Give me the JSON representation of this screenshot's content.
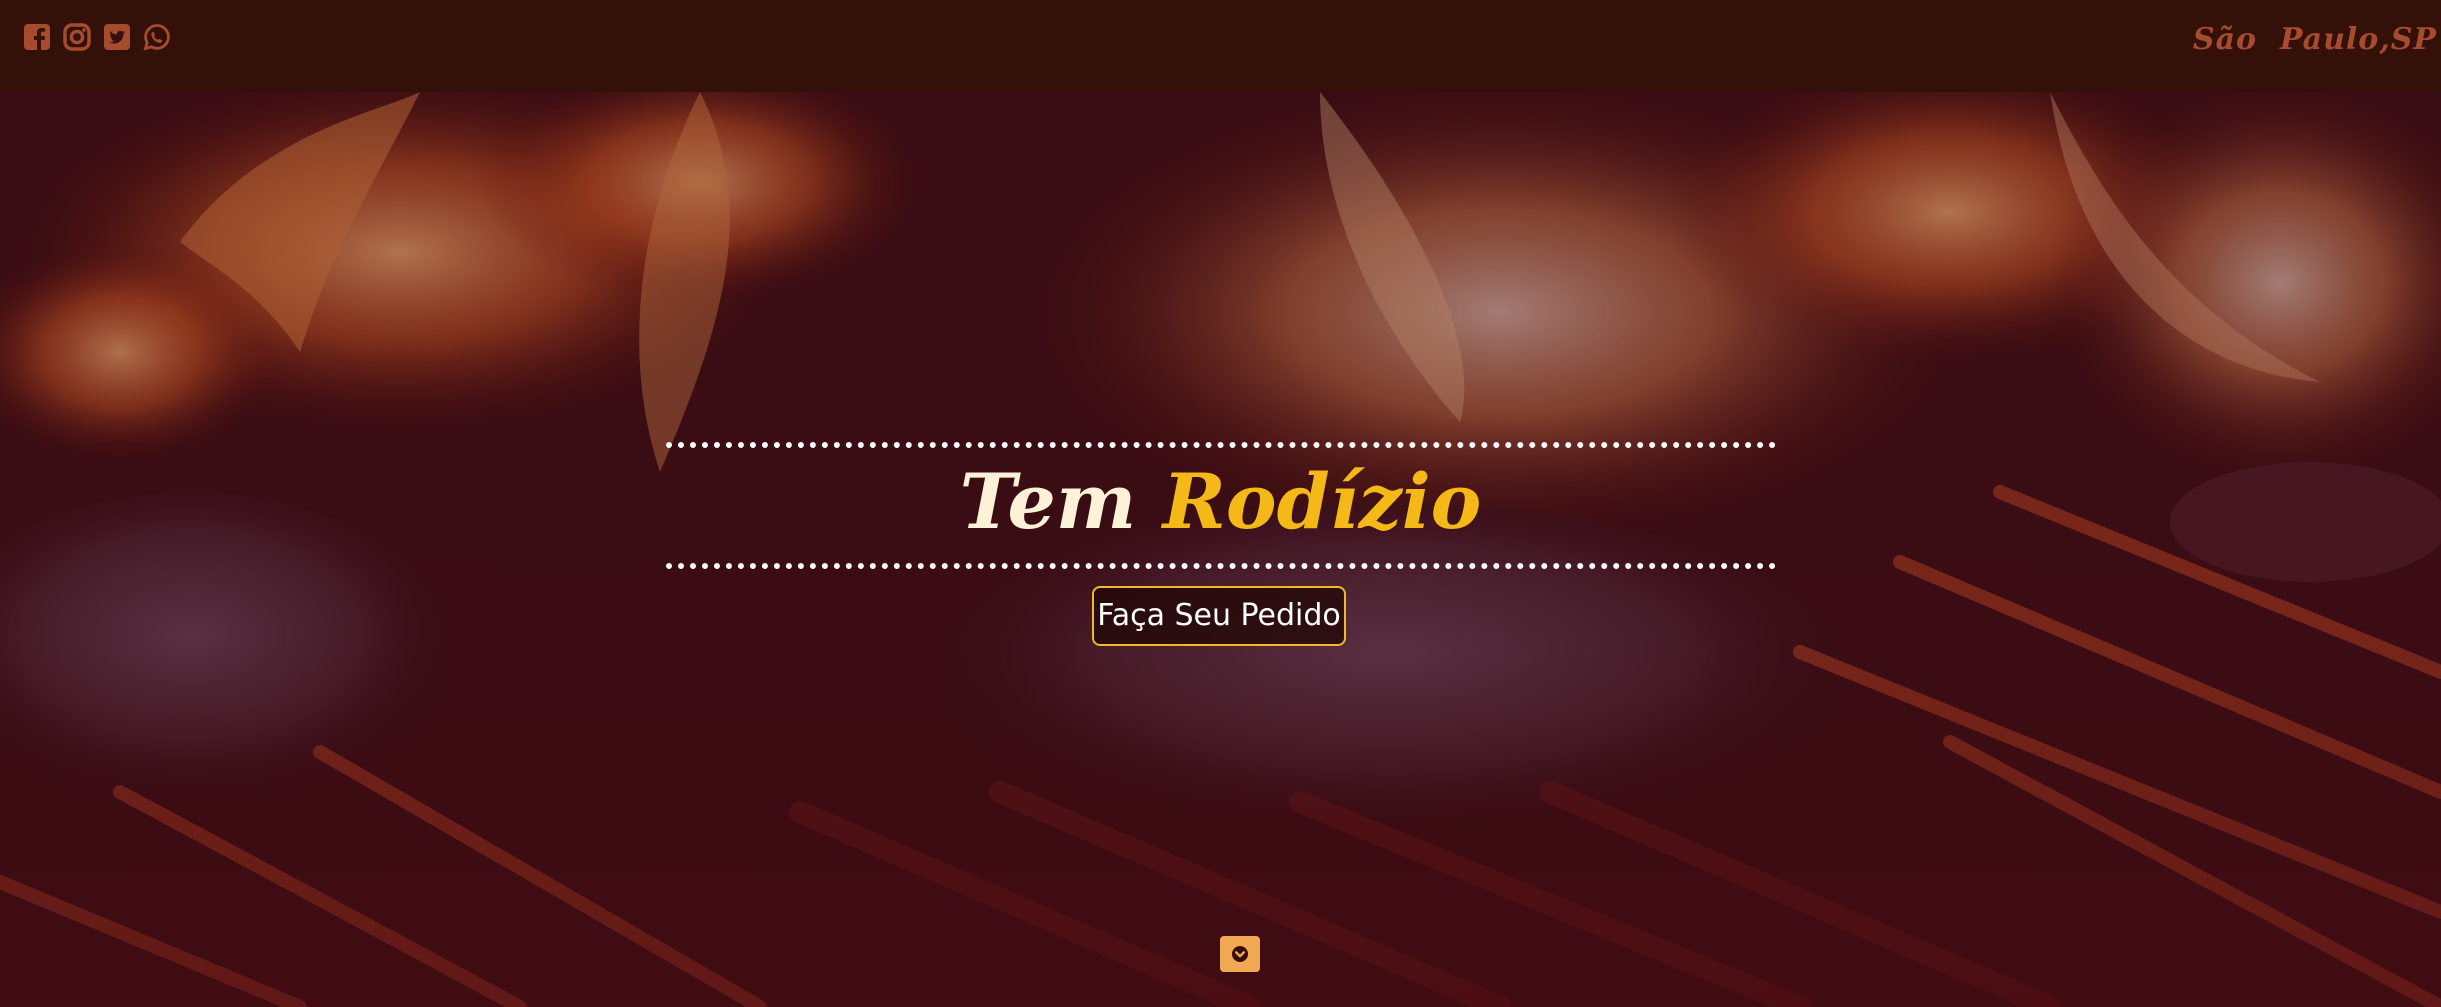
{
  "header": {
    "social_icons": [
      "facebook-icon",
      "instagram-icon",
      "twitter-icon",
      "whatsapp-icon"
    ],
    "location": "São  Paulo,SP"
  },
  "hero": {
    "headline_part1": "Tem",
    "headline_part2": "Rodízio",
    "cta_label": "Faça Seu Pedido",
    "scroll_icon": "chevron-down-icon"
  },
  "colors": {
    "topbar": "#341108",
    "icon": "#a74b2f",
    "accent": "#f4b817",
    "cta_border": "#f0b929",
    "scroll_button": "#f2a953"
  }
}
